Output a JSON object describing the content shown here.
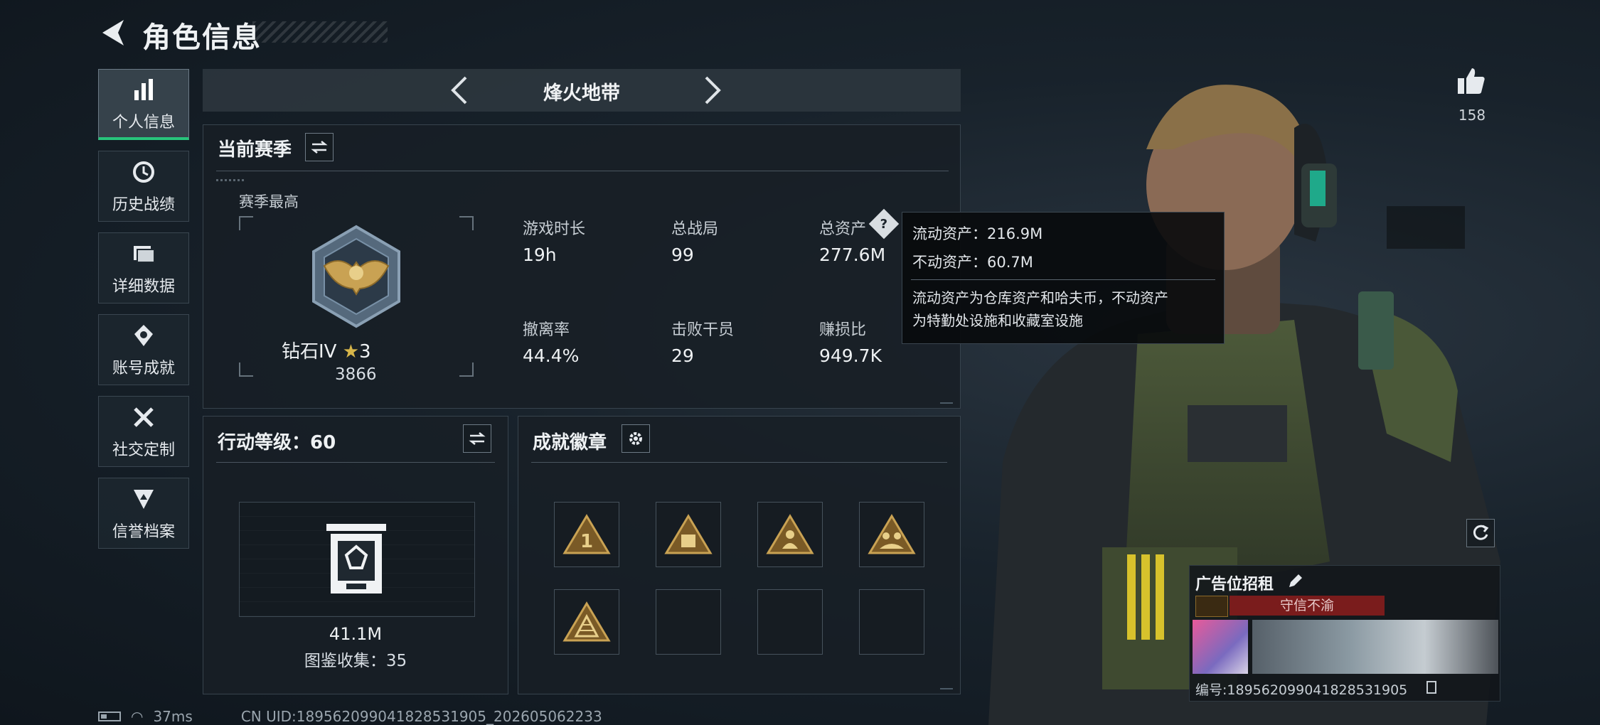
{
  "header": {
    "title": "角色信息"
  },
  "sidebar": {
    "items": [
      {
        "label": "个人信息",
        "icon": "bar-chart-icon",
        "active": true
      },
      {
        "label": "历史战绩",
        "icon": "history-icon",
        "active": false
      },
      {
        "label": "详细数据",
        "icon": "folder-icon",
        "active": false
      },
      {
        "label": "账号成就",
        "icon": "achievement-icon",
        "active": false
      },
      {
        "label": "社交定制",
        "icon": "tools-icon",
        "active": false
      },
      {
        "label": "信誉档案",
        "icon": "shield-icon",
        "active": false
      }
    ]
  },
  "mode": {
    "title": "烽火地带"
  },
  "season": {
    "title": "当前赛季",
    "best_label": "赛季最高",
    "rank_name": "钻石IV",
    "rank_stars": "3",
    "rank_points": "3866",
    "stats": [
      {
        "label": "游戏时长",
        "value": "19h"
      },
      {
        "label": "总战局",
        "value": "99"
      },
      {
        "label": "总资产",
        "value": "277.6M"
      },
      {
        "label": "撤离率",
        "value": "44.4%"
      },
      {
        "label": "击败干员",
        "value": "29"
      },
      {
        "label": "赚损比",
        "value": "949.7K"
      }
    ]
  },
  "tooltip": {
    "liquid": "流动资产：216.9M",
    "fixed": "不动资产：60.7M",
    "desc_line1": "流动资产为仓库资产和哈夫币，不动资产",
    "desc_line2": "为特勤处设施和收藏室设施"
  },
  "action_level": {
    "title": "行动等级：60",
    "value": "41.1M",
    "collection": "图鉴收集：35"
  },
  "achievements": {
    "title": "成就徽章",
    "badges": [
      {
        "filled": true,
        "icon": "badge-number-one-icon"
      },
      {
        "filled": true,
        "icon": "badge-crate-icon"
      },
      {
        "filled": true,
        "icon": "badge-soldier-icon"
      },
      {
        "filled": true,
        "icon": "badge-squad-icon"
      },
      {
        "filled": true,
        "icon": "badge-pyramid-icon"
      },
      {
        "filled": false
      },
      {
        "filled": false
      },
      {
        "filled": false
      }
    ]
  },
  "likes": {
    "count": "158"
  },
  "card": {
    "title": "广告位招租",
    "tag": "守信不渝",
    "id_text": "编号:1895620990418285319​05"
  },
  "status": {
    "ping": "37ms",
    "uid": "CN UID:1895620990418285319​05_202605062233"
  },
  "colors": {
    "accent_green": "#27c47b",
    "tag_red": "#7a1c1c",
    "gold": "#c9a253"
  }
}
